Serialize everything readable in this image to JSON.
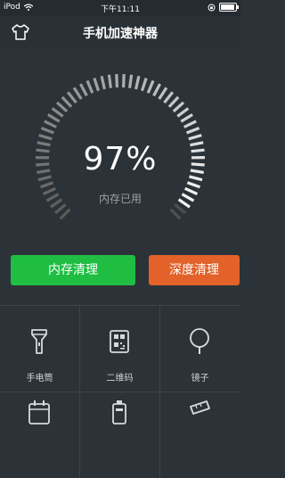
{
  "status_bar": {
    "carrier": "iPod",
    "time": "下午11:11"
  },
  "header": {
    "title": "手机加速神器",
    "left_icon": "shirt-icon"
  },
  "gauge": {
    "value_label": "97%",
    "label": "内存已用",
    "fraction": 0.97
  },
  "buttons": {
    "memory_clean": "内存清理",
    "deep_clean": "深度清理"
  },
  "tools": [
    {
      "label": "手电筒",
      "icon": "flashlight-icon"
    },
    {
      "label": "二维码",
      "icon": "qrcode-icon"
    },
    {
      "label": "镜子",
      "icon": "mirror-icon"
    },
    {
      "label": "",
      "icon": "calendar-icon"
    },
    {
      "label": "",
      "icon": "battery-icon"
    },
    {
      "label": "",
      "icon": "ruler-icon"
    }
  ],
  "colors": {
    "accent_green": "#1fbe43",
    "accent_orange": "#e2622a",
    "background": "#2c3338"
  }
}
